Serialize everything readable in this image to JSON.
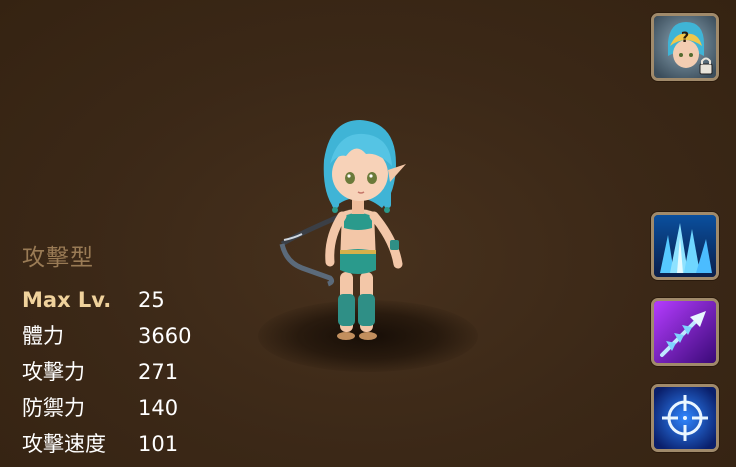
{
  "hero": {
    "type": "攻擊型",
    "stats": [
      {
        "label": "Max Lv.",
        "value": "25"
      },
      {
        "label": "體力",
        "value": "3660"
      },
      {
        "label": "攻擊力",
        "value": "271"
      },
      {
        "label": "防禦力",
        "value": "140"
      },
      {
        "label": "攻擊速度",
        "value": "101"
      }
    ]
  },
  "buttons": {
    "portrait": {
      "icon": "locked-hero-portrait-icon",
      "glyph": "?",
      "locked": true
    },
    "skills": [
      {
        "icon": "ice-spikes-icon",
        "color": "#2fa8ff"
      },
      {
        "icon": "piercing-arrow-icon",
        "color": "#9b2cff"
      },
      {
        "icon": "crosshair-target-icon",
        "color": "#1e6cff"
      }
    ]
  },
  "colors": {
    "background": "#3b2817",
    "type_label": "#9a7b55",
    "max_lv_label": "#f0d29c",
    "frame": "#a08a6b"
  }
}
